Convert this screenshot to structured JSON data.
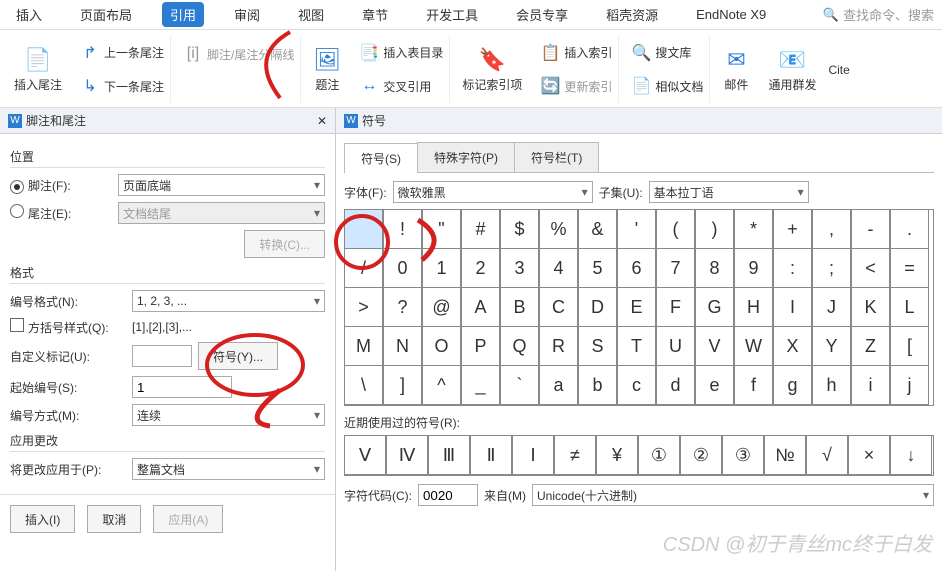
{
  "tabs": [
    "插入",
    "页面布局",
    "引用",
    "审阅",
    "视图",
    "章节",
    "开发工具",
    "会员专享",
    "稻壳资源",
    "EndNote X9"
  ],
  "active_tab": "引用",
  "search_placeholder": "查找命令、搜索",
  "toolbar": {
    "insert_footnote": "插入尾注",
    "prev_footnote": "上一条尾注",
    "next_footnote": "下一条尾注",
    "sep_line": "脚注/尾注分隔线",
    "caption": "题注",
    "insert_toc": "插入表目录",
    "cross_ref": "交叉引用",
    "mark_index": "标记索引项",
    "insert_index": "插入索引",
    "update_index": "更新索引",
    "search_lib": "搜文库",
    "similar_doc": "相似文档",
    "mail": "邮件",
    "mass_send": "通用群发",
    "cite": "Cite"
  },
  "panel": {
    "title": "脚注和尾注",
    "section_pos": "位置",
    "footnote": "脚注(F):",
    "footnote_val": "页面底端",
    "endnote": "尾注(E):",
    "endnote_val": "文档结尾",
    "convert": "转换(C)...",
    "section_fmt": "格式",
    "num_fmt": "编号格式(N):",
    "num_fmt_val": "1, 2, 3, ...",
    "bracket": "方括号样式(Q):",
    "bracket_val": "[1],[2],[3],...",
    "custom": "自定义标记(U):",
    "symbol_btn": "符号(Y)...",
    "start_at": "起始编号(S):",
    "start_at_val": "1",
    "numbering": "编号方式(M):",
    "numbering_val": "连续",
    "section_apply": "应用更改",
    "apply_to": "将更改应用于(P):",
    "apply_to_val": "整篇文档",
    "insert": "插入(I)",
    "cancel": "取消",
    "apply": "应用(A)"
  },
  "sym": {
    "title": "符号",
    "tab_sym": "符号(S)",
    "tab_special": "特殊字符(P)",
    "tab_bar": "符号栏(T)",
    "font": "字体(F):",
    "font_val": "微软雅黑",
    "subset": "子集(U):",
    "subset_val": "基本拉丁语",
    "grid": [
      [
        " ",
        "!",
        "\"",
        "#",
        "$",
        "%",
        "&",
        "'",
        "(",
        ")",
        "*",
        "+",
        ",",
        "-"
      ],
      [
        ".",
        "/",
        "0",
        "1",
        "2",
        "3",
        "4",
        "5",
        "6",
        "7",
        "8",
        "9",
        ":",
        ";"
      ],
      [
        "<",
        "=",
        ">",
        "?",
        "@",
        "A",
        "B",
        "C",
        "D",
        "E",
        "F",
        "G",
        "H",
        "I"
      ],
      [
        "J",
        "K",
        "L",
        "M",
        "N",
        "O",
        "P",
        "Q",
        "R",
        "S",
        "T",
        "U",
        "V",
        "W"
      ],
      [
        "X",
        "Y",
        "Z",
        "[",
        "\\",
        "]",
        "^",
        "_",
        "`",
        "a",
        "b",
        "c",
        "d",
        "e"
      ]
    ],
    "grid_display": [
      [
        " ",
        "!",
        "\"",
        "#",
        "$",
        "%",
        "&",
        "'",
        "(",
        ")",
        "*",
        "+",
        ",",
        "-",
        "."
      ],
      [
        "/",
        "0",
        "1",
        "2",
        "3",
        "4",
        "5",
        "6",
        "7",
        "8",
        "9",
        ":",
        ";",
        "<",
        "="
      ],
      [
        ">",
        "?",
        "@",
        "A",
        "B",
        "C",
        "D",
        "E",
        "F",
        "G",
        "H",
        "I",
        "J",
        "K",
        "L"
      ],
      [
        "M",
        "N",
        "O",
        "P",
        "Q",
        "R",
        "S",
        "T",
        "U",
        "V",
        "W",
        "X",
        "Y",
        "Z",
        "["
      ],
      [
        "\\",
        "]",
        "^",
        "_",
        "`",
        "a",
        "b",
        "c",
        "d",
        "e",
        "f",
        "g",
        "h",
        "i",
        "j"
      ]
    ],
    "recent_label": "近期使用过的符号(R):",
    "recent": [
      "Ⅴ",
      "Ⅳ",
      "Ⅲ",
      "Ⅱ",
      "Ⅰ",
      "≠",
      "¥",
      "①",
      "②",
      "③",
      "№",
      "√",
      "×",
      "↓"
    ],
    "code_label": "字符代码(C):",
    "code_val": "0020",
    "from_label": "来自(M)",
    "from_val": "Unicode(十六进制)"
  },
  "watermark": "CSDN @初于青丝mc终于白发"
}
